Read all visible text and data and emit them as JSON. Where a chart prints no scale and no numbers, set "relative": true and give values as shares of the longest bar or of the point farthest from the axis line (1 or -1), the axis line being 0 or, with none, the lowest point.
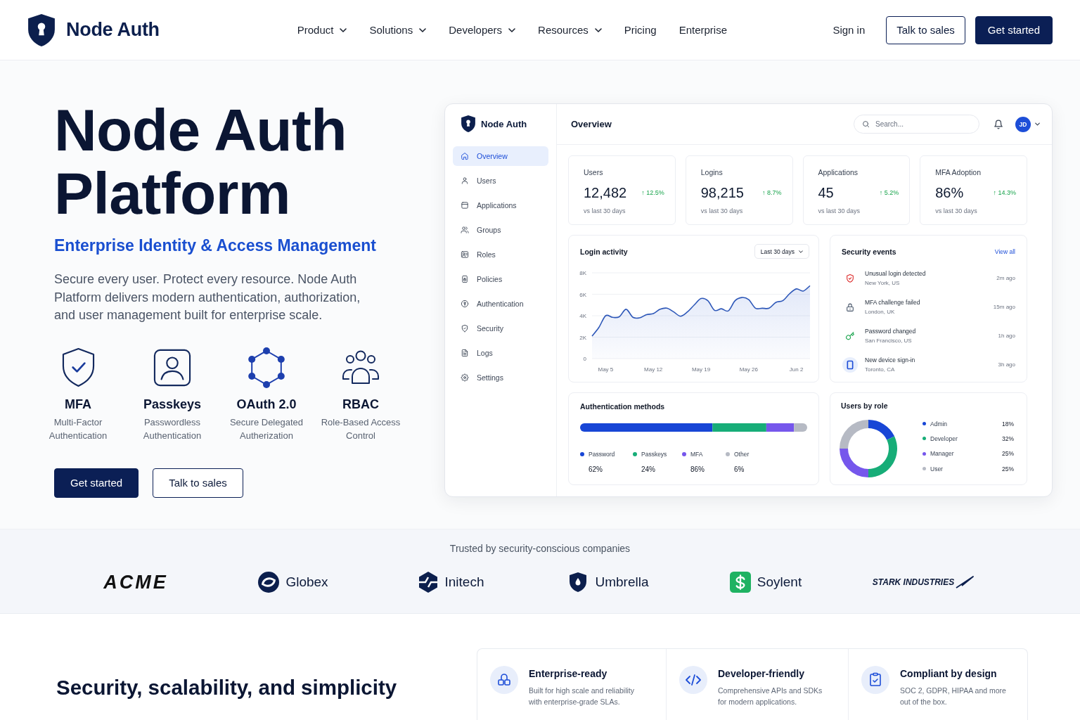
{
  "header": {
    "brand": "Node Auth",
    "nav": [
      {
        "label": "Product",
        "kind": "menu"
      },
      {
        "label": "Solutions",
        "kind": "menu"
      },
      {
        "label": "Developers",
        "kind": "menu"
      },
      {
        "label": "Resources",
        "kind": "menu"
      },
      {
        "label": "Pricing",
        "kind": "link"
      },
      {
        "label": "Enterprise",
        "kind": "link"
      }
    ],
    "sign_in": "Sign in",
    "buttons": [
      {
        "label": "Talk to sales",
        "kind": "secondary"
      },
      {
        "label": "Get started",
        "kind": "primary"
      }
    ]
  },
  "hero": {
    "title": "Node Auth Platform",
    "subtitle": "Enterprise Identity & Access Management",
    "description": "Secure every user. Protect every resource. Node Auth Platform delivers modern authentication, authorization, and user management built for enterprise scale.",
    "features": [
      {
        "title": "MFA",
        "description": "Multi-Factor Authentication"
      },
      {
        "title": "Passkeys",
        "description": "Passwordless Authentication"
      },
      {
        "title": "OAuth 2.0",
        "description": "Secure Delegated Autherization"
      },
      {
        "title": "RBAC",
        "description": "Role-Based Access Control"
      }
    ],
    "buttons": [
      {
        "label": "Get started",
        "kind": "primary"
      },
      {
        "label": "Talk to sales",
        "kind": "secondary"
      }
    ]
  },
  "dashboard": {
    "brand": "Node Auth",
    "sidebar": {
      "items": [
        {
          "label": "Overview",
          "selected": true
        },
        {
          "label": "Users",
          "selected": false
        },
        {
          "label": "Applications",
          "selected": false
        },
        {
          "label": "Groups",
          "selected": false
        },
        {
          "label": "Roles",
          "selected": false
        },
        {
          "label": "Policies",
          "selected": false
        },
        {
          "label": "Authentication",
          "selected": false
        },
        {
          "label": "Security",
          "selected": false
        },
        {
          "label": "Logs",
          "selected": false
        },
        {
          "label": "Settings",
          "selected": false
        }
      ]
    },
    "page_title": "Overview",
    "search": {
      "placeholder": "Search..."
    },
    "avatar": "JD",
    "stats": [
      {
        "label": "Users",
        "value": "12,482",
        "change": "↑ 12.5%",
        "note": "vs last 30 days"
      },
      {
        "label": "Logins",
        "value": "98,215",
        "change": "↑ 8.7%",
        "note": "vs last 30 days"
      },
      {
        "label": "Applications",
        "value": "45",
        "change": "↑ 5.2%",
        "note": "vs last 30 days"
      },
      {
        "label": "MFA Adoption",
        "value": "86%",
        "change": "↑ 14.3%",
        "note": "vs last 30 days"
      }
    ],
    "login_activity": {
      "range": "Last 30 days",
      "chart_data": {
        "type": "area",
        "title": "Login activity",
        "grid": true,
        "categories": [
          null,
          null,
          "May 5",
          null,
          null,
          null,
          null,
          null,
          null,
          "May 12",
          null,
          null,
          null,
          null,
          null,
          null,
          "May 19",
          null,
          null,
          null,
          null,
          null,
          null,
          "May 26",
          null,
          null,
          null,
          null,
          null,
          null,
          "Jun 2",
          null,
          null
        ],
        "values": [
          2100,
          2900,
          4000,
          3850,
          3900,
          4600,
          3850,
          3800,
          4100,
          4200,
          4600,
          4700,
          4350,
          3950,
          4350,
          5000,
          5600,
          5400,
          4500,
          4650,
          4450,
          5400,
          5700,
          5500,
          4700,
          4700,
          4700,
          5250,
          5400,
          6050,
          6500,
          6300,
          6800
        ],
        "ylim": [
          0,
          8000
        ],
        "yticks": [
          {
            "value": 0,
            "label": "0"
          },
          {
            "value": 2000,
            "label": "2K"
          },
          {
            "value": 4000,
            "label": "4K"
          },
          {
            "value": 6000,
            "label": "6K"
          },
          {
            "value": 8000,
            "label": "8K"
          }
        ]
      }
    },
    "security_events": {
      "title": "Security events",
      "link": "View all",
      "events": [
        {
          "title": "Unusual login detected",
          "location": "New York, US",
          "time": "2m ago"
        },
        {
          "title": "MFA challenge failed",
          "location": "London, UK",
          "time": "15m ago"
        },
        {
          "title": "Password changed",
          "location": "San Francisco, US",
          "time": "1h ago"
        },
        {
          "title": "New device sign-in",
          "location": "Toronto, CA",
          "time": "3h ago"
        }
      ]
    },
    "auth_methods": {
      "title": "Authentication methods",
      "chart_data": {
        "type": "bar",
        "orientation": "horizontal",
        "stacked": true,
        "relative": true,
        "categories": [
          null
        ],
        "series": [
          {
            "name": "Password",
            "color": "#1846d6",
            "values": [
              0.583
            ]
          },
          {
            "name": "Passkeys",
            "color": "#17ad78",
            "values": [
              0.237
            ]
          },
          {
            "name": "MFA",
            "color": "#7657ec",
            "values": [
              0.122
            ]
          },
          {
            "name": "Other",
            "color": "#b6bac4",
            "values": [
              0.058
            ]
          }
        ]
      },
      "legend_values": [
        "62%",
        "24%",
        "86%",
        "6%"
      ]
    },
    "users_by_role": {
      "title": "Users by role",
      "roles": [
        {
          "label": "Admin",
          "value": "18%",
          "color": "#1846d6"
        },
        {
          "label": "Developer",
          "value": "32%",
          "color": "#17ad78"
        },
        {
          "label": "Manager",
          "value": "25%",
          "color": "#7657ec"
        },
        {
          "label": "User",
          "value": "25%",
          "color": "#b6bac4"
        }
      ],
      "chart_data": {
        "type": "donut",
        "values": [
          18,
          32,
          25,
          25
        ]
      }
    }
  },
  "trusted": {
    "heading": "Trusted by security-conscious companies",
    "logos": [
      {
        "name": "ACME",
        "kind": "wordmark"
      },
      {
        "name": "Globex",
        "kind": "mark"
      },
      {
        "name": "Initech",
        "kind": "mark"
      },
      {
        "name": "Umbrella",
        "kind": "mark"
      },
      {
        "name": "Soylent",
        "kind": "mark"
      },
      {
        "name": "STARK INDUSTRIES",
        "kind": "wordmark"
      }
    ]
  },
  "highlights": {
    "heading": "Security, scalability, and simplicity",
    "items": [
      {
        "title": "Enterprise-ready",
        "description": "Built for high scale and reliability with enterprise-grade SLAs."
      },
      {
        "title": "Developer-friendly",
        "description": "Comprehensive APIs and SDKs for modern applications."
      },
      {
        "title": "Compliant by design",
        "description": "SOC 2, GDPR, HIPAA and more out of the box."
      }
    ]
  }
}
